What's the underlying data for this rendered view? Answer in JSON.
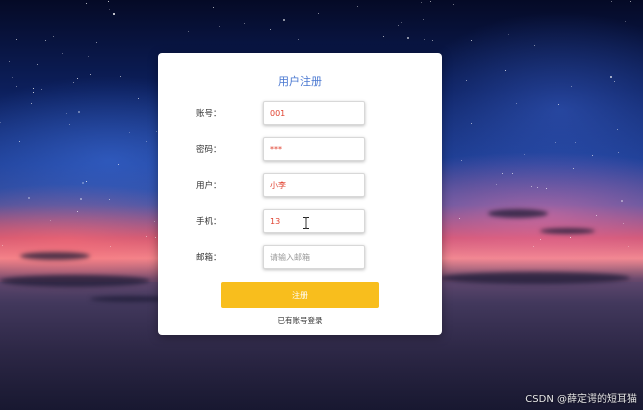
{
  "form": {
    "title": "用户注册",
    "fields": [
      {
        "label": "账号：",
        "value": "001",
        "placeholder": "",
        "type": "text"
      },
      {
        "label": "密码：",
        "value": "***",
        "placeholder": "",
        "type": "password"
      },
      {
        "label": "用户：",
        "value": "小李",
        "placeholder": "",
        "type": "text"
      },
      {
        "label": "手机：",
        "value": "13",
        "placeholder": "",
        "type": "text"
      },
      {
        "label": "邮箱：",
        "value": "",
        "placeholder": "请输入邮箱",
        "type": "text"
      }
    ],
    "submit_label": "注册",
    "login_link": "已有账号登录"
  },
  "watermark": "CSDN @薛定谔的短耳猫",
  "colors": {
    "title": "#4a78d1",
    "input_text": "#e0412f",
    "submit_bg": "#f8be1d",
    "card_bg": "#ffffff"
  },
  "icons": {
    "text_cursor": "i-beam-cursor-icon"
  }
}
